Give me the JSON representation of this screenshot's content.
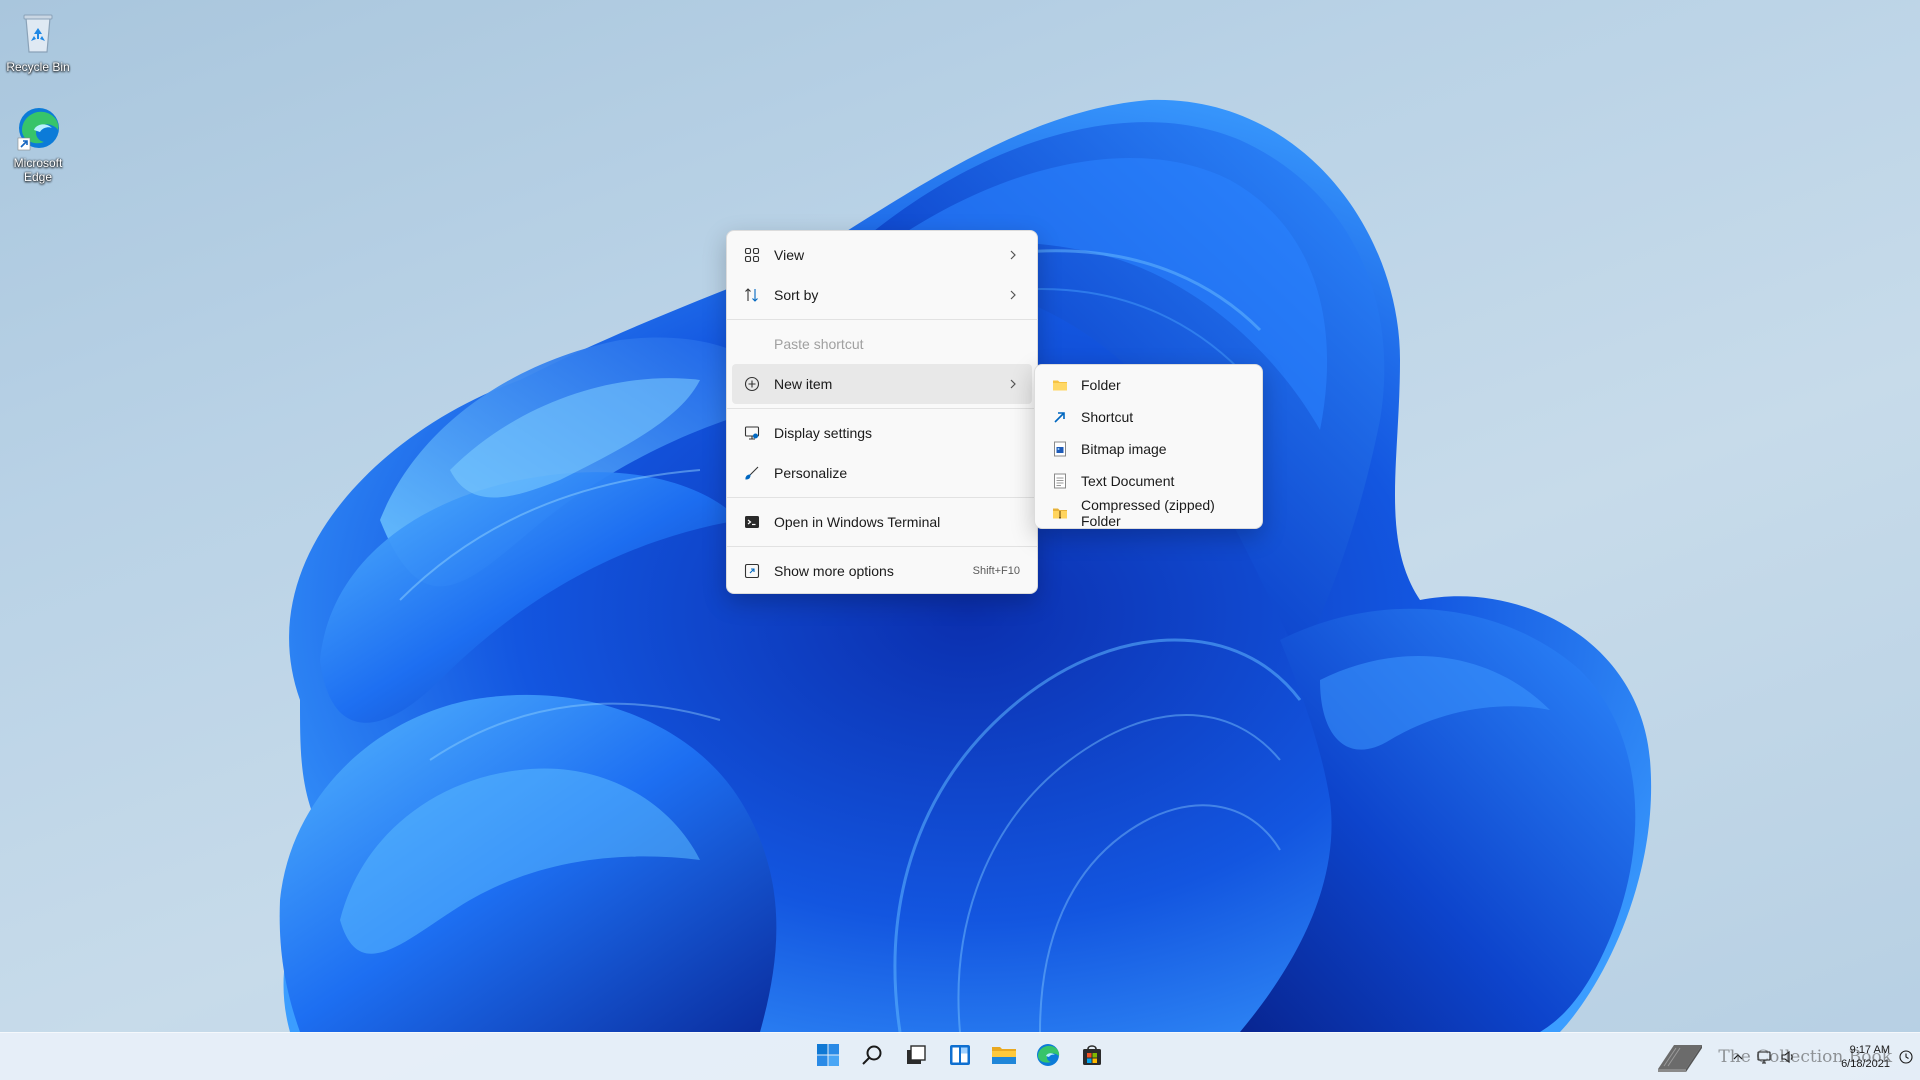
{
  "desktop": {
    "icons": [
      {
        "label": "Recycle Bin",
        "icon": "recycle-bin-icon"
      },
      {
        "label": "Microsoft Edge",
        "icon": "edge-icon"
      }
    ]
  },
  "context_menu": {
    "items": [
      {
        "label": "View",
        "icon": "view-grid-icon",
        "has_submenu": true
      },
      {
        "label": "Sort by",
        "icon": "sort-icon",
        "has_submenu": true
      },
      {
        "label": "Paste shortcut",
        "disabled": true
      },
      {
        "label": "New item",
        "icon": "new-item-plus-icon",
        "has_submenu": true,
        "highlighted": true
      },
      {
        "label": "Display settings",
        "icon": "display-settings-icon"
      },
      {
        "label": "Personalize",
        "icon": "personalize-brush-icon"
      },
      {
        "label": "Open in Windows Terminal",
        "icon": "terminal-icon"
      },
      {
        "label": "Show more options",
        "icon": "show-more-icon",
        "shortcut": "Shift+F10"
      }
    ]
  },
  "new_submenu": {
    "items": [
      {
        "label": "Folder",
        "icon": "folder-icon"
      },
      {
        "label": "Shortcut",
        "icon": "shortcut-arrow-icon"
      },
      {
        "label": "Bitmap image",
        "icon": "bitmap-image-icon"
      },
      {
        "label": "Text Document",
        "icon": "text-document-icon"
      },
      {
        "label": "Compressed (zipped) Folder",
        "icon": "zip-folder-icon"
      }
    ]
  },
  "taskbar": {
    "apps": [
      {
        "name": "Start",
        "icon": "windows-start-icon"
      },
      {
        "name": "Search",
        "icon": "search-icon"
      },
      {
        "name": "Task View",
        "icon": "task-view-icon"
      },
      {
        "name": "Widgets",
        "icon": "widgets-icon"
      },
      {
        "name": "File Explorer",
        "icon": "file-explorer-icon"
      },
      {
        "name": "Microsoft Edge",
        "icon": "edge-icon"
      },
      {
        "name": "Microsoft Store",
        "icon": "store-icon"
      }
    ],
    "clock": {
      "time": "9:17 AM",
      "date": "6/18/2021"
    },
    "watermark": "The Collection Book"
  },
  "colors": {
    "accent": "#0067c0",
    "bloom_dark": "#0a35b8",
    "bloom_light": "#3fa4ff",
    "menu_bg": "#f9f9f9"
  }
}
